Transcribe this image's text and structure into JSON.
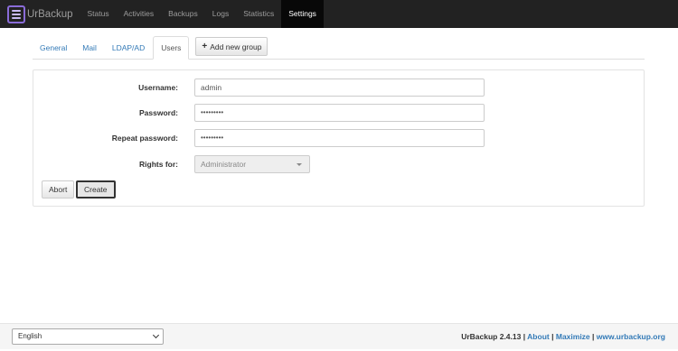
{
  "nav": {
    "brand": "UrBackup",
    "items": [
      {
        "label": "Status",
        "active": false
      },
      {
        "label": "Activities",
        "active": false
      },
      {
        "label": "Backups",
        "active": false
      },
      {
        "label": "Logs",
        "active": false
      },
      {
        "label": "Statistics",
        "active": false
      },
      {
        "label": "Settings",
        "active": true
      }
    ]
  },
  "tabs": {
    "items": [
      {
        "label": "General",
        "active": false
      },
      {
        "label": "Mail",
        "active": false
      },
      {
        "label": "LDAP/AD",
        "active": false
      },
      {
        "label": "Users",
        "active": true
      }
    ],
    "add_group_label": "Add new group"
  },
  "form": {
    "username_label": "Username:",
    "username_value": "admin",
    "password_label": "Password:",
    "password_value": "•••••••••",
    "repeat_password_label": "Repeat password:",
    "repeat_password_value": "•••••••••",
    "rights_label": "Rights for:",
    "rights_value": "Administrator",
    "abort_label": "Abort",
    "create_label": "Create"
  },
  "footer": {
    "language": "English",
    "version": "UrBackup 2.4.13",
    "sep": "|",
    "about": "About",
    "maximize": "Maximize",
    "website": "www.urbackup.org"
  },
  "colors": {
    "navbar": "#222222",
    "link": "#337ab7",
    "logo": "#8a6cd8"
  }
}
